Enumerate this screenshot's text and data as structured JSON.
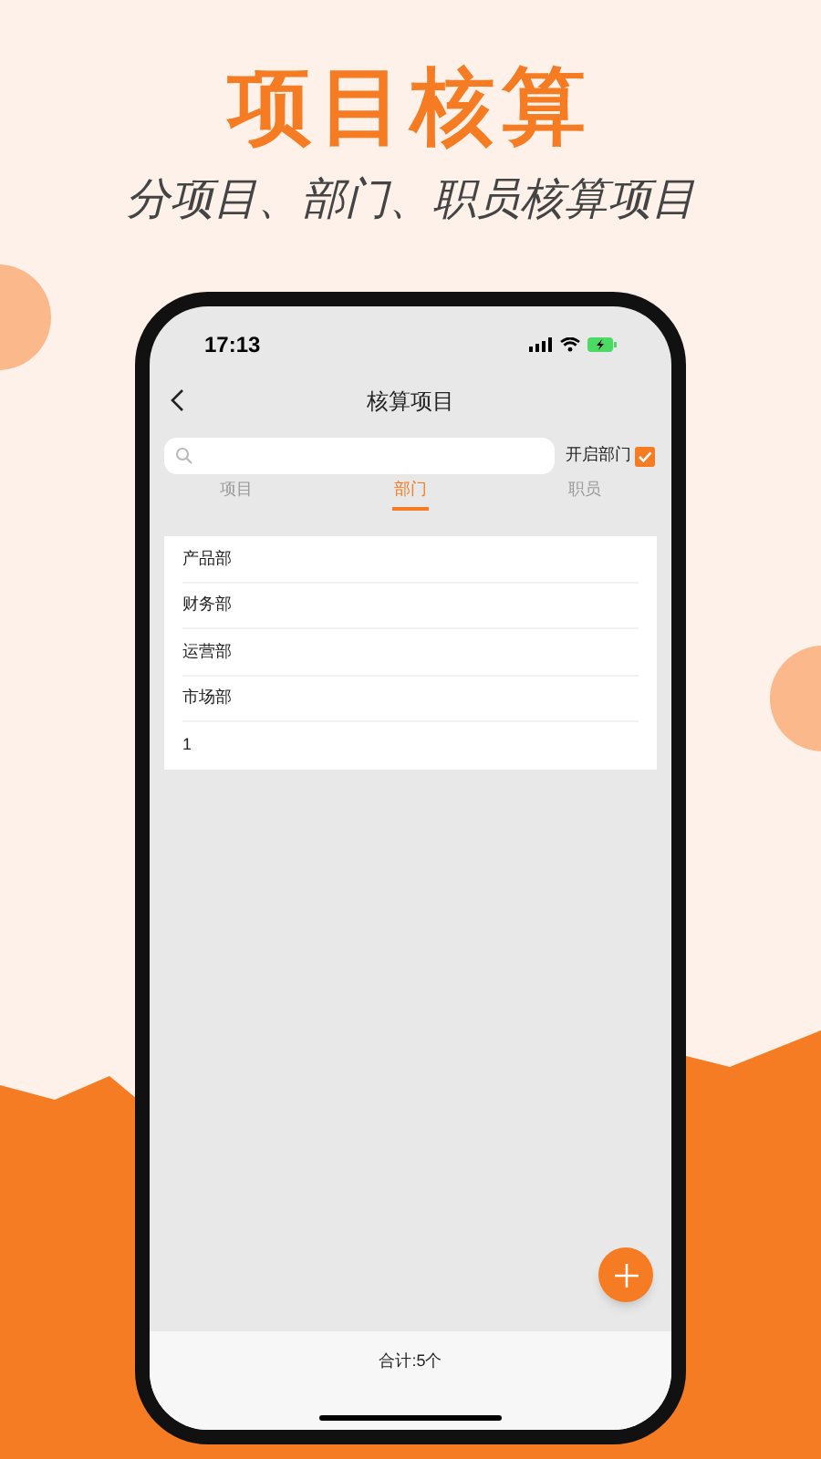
{
  "headline": "项目核算",
  "subtitle": "分项目、部门、职员核算项目",
  "status_bar": {
    "time": "17:13"
  },
  "nav": {
    "title": "核算项目"
  },
  "toggle": {
    "label": "开启部门",
    "checked": true
  },
  "tabs": [
    {
      "label": "项目",
      "selected": false
    },
    {
      "label": "部门",
      "selected": true
    },
    {
      "label": "职员",
      "selected": false
    }
  ],
  "list": [
    {
      "label": "产品部"
    },
    {
      "label": "财务部"
    },
    {
      "label": "运营部"
    },
    {
      "label": "市场部"
    },
    {
      "label": "1"
    }
  ],
  "footer": {
    "total": "合计:5个"
  }
}
